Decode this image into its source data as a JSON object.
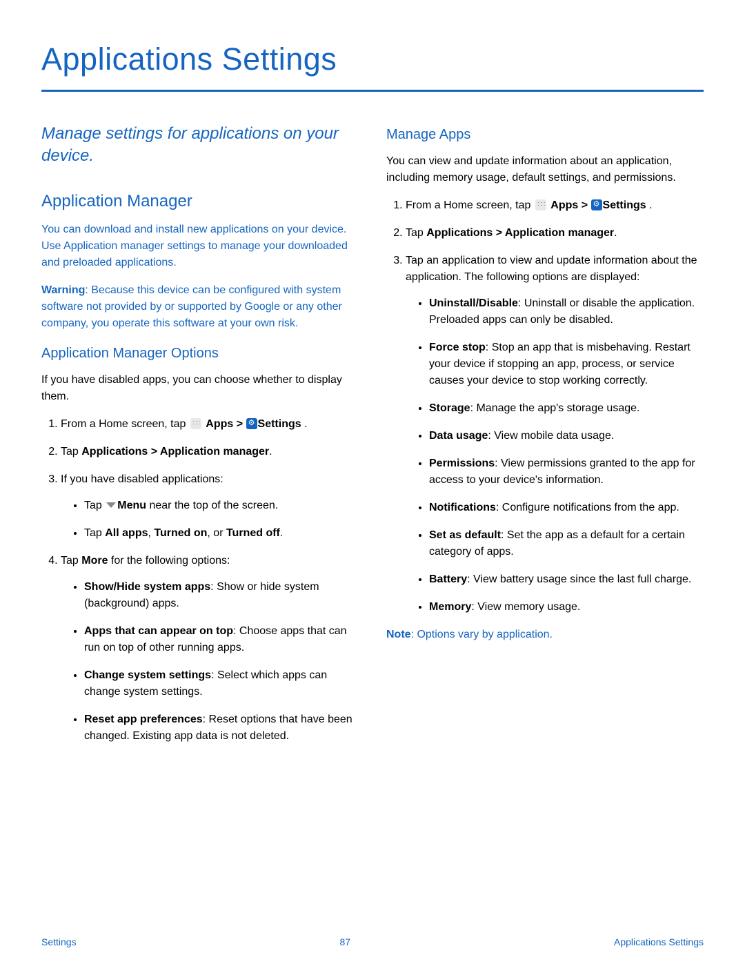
{
  "title": "Applications Settings",
  "intro": "Manage settings for applications on your device.",
  "section_app_manager": {
    "heading": "Application Manager",
    "p1": "You can download and install new applications on your device. Use Application manager settings to manage your downloaded and preloaded applications.",
    "warning_label": "Warning",
    "warning_text": ": Because this device can be configured with system software not provided by or supported by Google or any other company, you operate this software at your own risk.",
    "options_heading": "Application Manager Options",
    "options_intro": "If you have disabled apps, you can choose whether to display them.",
    "step1_pre": "From a Home screen, tap ",
    "step1_apps": "Apps > ",
    "step1_settings": "Settings",
    "step1_post": " .",
    "step2_pre": "Tap ",
    "step2_bold": "Applications > Application manager",
    "step2_post": ".",
    "step3": "If you have disabled applications:",
    "step3_b1_pre": "Tap ",
    "step3_b1_bold": "Menu",
    "step3_b1_post": " near the top of the screen.",
    "step3_b2_pre": "Tap ",
    "step3_b2_bold1": "All apps",
    "step3_b2_mid1": ", ",
    "step3_b2_bold2": "Turned on",
    "step3_b2_mid2": ", or ",
    "step3_b2_bold3": "Turned off",
    "step3_b2_post": ".",
    "step4_pre": "Tap ",
    "step4_bold": "More",
    "step4_post": " for the following options:",
    "step4_items": [
      {
        "bold": "Show/Hide system apps",
        "rest": ": Show or hide system (background) apps."
      },
      {
        "bold": "Apps that can appear on top",
        "rest": ": Choose apps that can run on top of other running apps."
      },
      {
        "bold": "Change system settings",
        "rest": ": Select which apps can change system settings."
      },
      {
        "bold": "Reset app preferences",
        "rest": ": Reset options that have been changed. Existing app data is not deleted."
      }
    ]
  },
  "section_manage_apps": {
    "heading": "Manage Apps",
    "p1": "You can view and update information about an application, including memory usage, default settings, and permissions.",
    "step1_pre": "From a Home screen, tap ",
    "step1_apps": "Apps > ",
    "step1_settings": "Settings",
    "step1_post": " .",
    "step2_pre": "Tap ",
    "step2_bold": "Applications > Application manager",
    "step2_post": ".",
    "step3": "Tap an application to view and update information about the application. The following options are displayed:",
    "items": [
      {
        "bold": "Uninstall/Disable",
        "rest": ": Uninstall or disable the application. Preloaded apps can only be disabled."
      },
      {
        "bold": "Force stop",
        "rest": ": Stop an app that is misbehaving. Restart your device if stopping an app, process, or service causes your device to stop working correctly."
      },
      {
        "bold": "Storage",
        "rest": ": Manage the app's storage usage."
      },
      {
        "bold": "Data usage",
        "rest": ": View mobile data usage."
      },
      {
        "bold": "Permissions",
        "rest": ": View permissions granted to the app for access to your device's information."
      },
      {
        "bold": "Notifications",
        "rest": ": Configure notifications from the app."
      },
      {
        "bold": "Set as default",
        "rest": ": Set the app as a default for a certain category of apps."
      },
      {
        "bold": "Battery",
        "rest": ": View battery usage since the last full charge."
      },
      {
        "bold": "Memory",
        "rest": ": View memory usage."
      }
    ],
    "note_label": "Note",
    "note_text": ": Options vary by application."
  },
  "footer": {
    "left": "Settings",
    "center": "87",
    "right": "Applications Settings"
  }
}
